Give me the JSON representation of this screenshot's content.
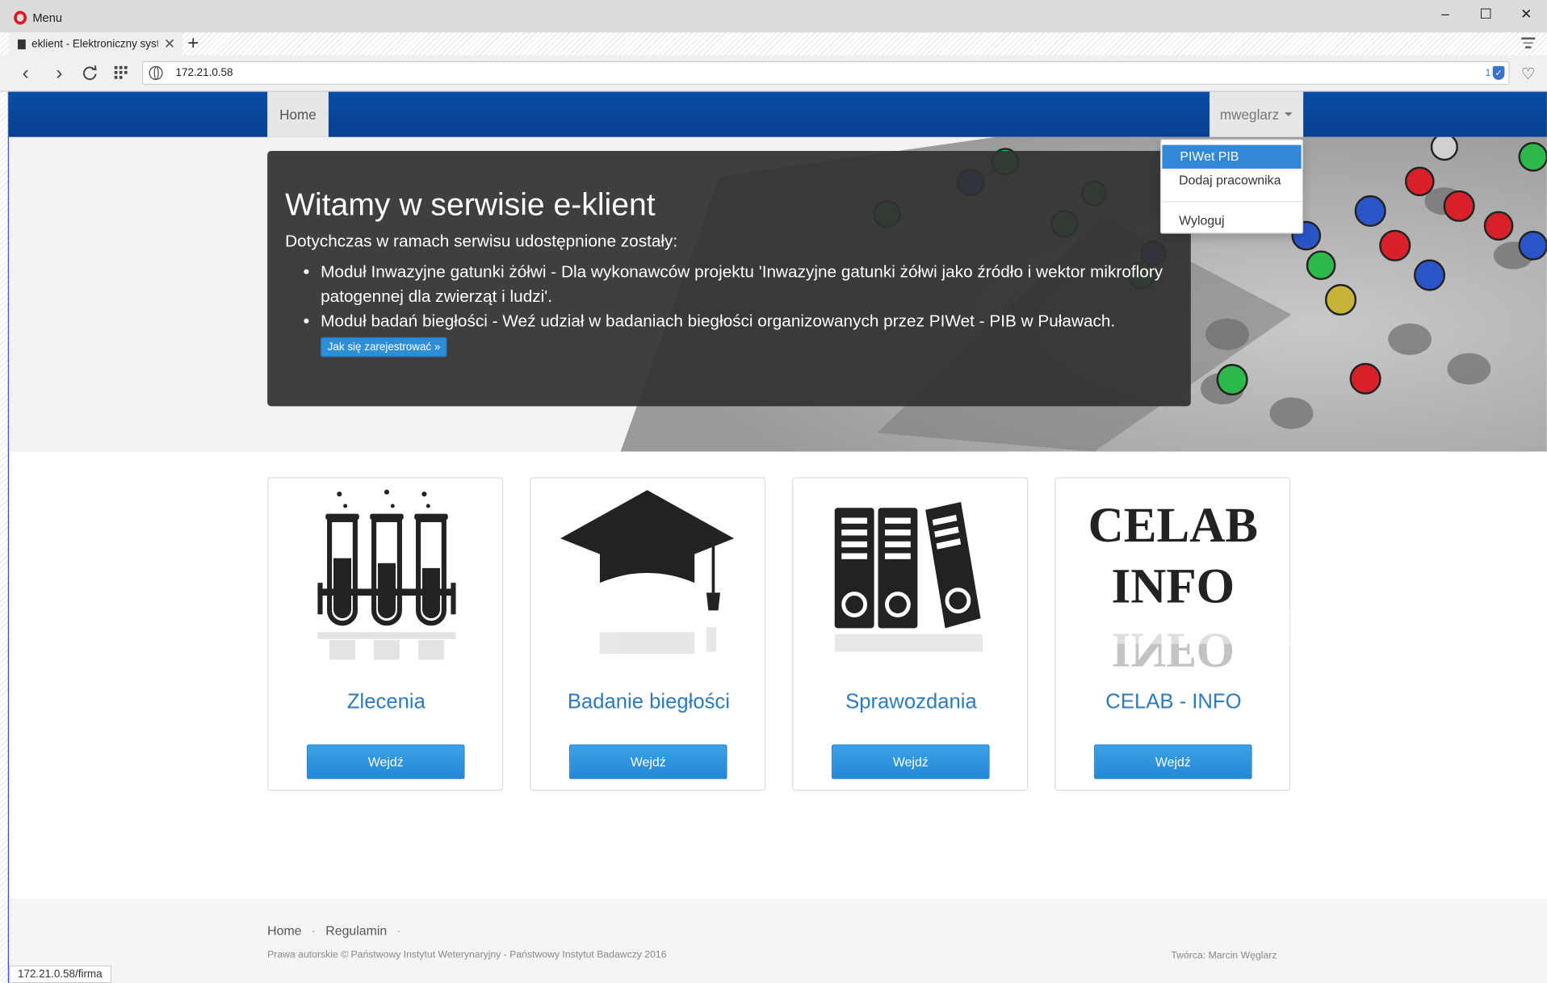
{
  "browser": {
    "menu_label": "Menu",
    "tab_title": "eklient - Elektroniczny syste",
    "url": "172.21.0.58",
    "shield_count": "1",
    "status_url": "172.21.0.58/firma"
  },
  "navbar": {
    "home": "Home",
    "user": "mweglarz"
  },
  "dropdown": {
    "items": [
      "PIWet PIB",
      "Dodaj pracownika"
    ],
    "logout": "Wyloguj"
  },
  "hero": {
    "title": "Witamy w serwisie e-klient",
    "intro": "Dotychczas w ramach serwisu udostępnione zostały:",
    "items": [
      "Moduł Inwazyjne gatunki żółwi - Dla wykonawców projektu 'Inwazyjne gatunki żółwi jako źródło i wektor mikroflory patogennej dla zwierząt i ludzi'.",
      "Moduł badań biegłości - Weź udział w badaniach biegłości organizowanych przez PIWet - PIB w Puławach."
    ],
    "register_button": "Jak się zarejestrować »"
  },
  "cards": [
    {
      "title": "Zlecenia",
      "button": "Wejdź",
      "icon": "test-tubes-icon"
    },
    {
      "title": "Badanie biegłości",
      "button": "Wejdź",
      "icon": "graduation-cap-icon"
    },
    {
      "title": "Sprawozdania",
      "button": "Wejdź",
      "icon": "binders-icon"
    },
    {
      "title": "CELAB - INFO",
      "button": "Wejdź",
      "icon": "celab-info-logo",
      "logo_text": [
        "CELAB",
        "INFO"
      ]
    }
  ],
  "footer": {
    "links": [
      "Home",
      "Regulamin"
    ],
    "copyright": "Prawa autorskie © Państwowy Instytut Weterynaryjny - Państwowy Instytut Badawczy 2016",
    "author": "Twórca: Marcin Węglarz"
  },
  "colors": {
    "navbar": "#0a4da6",
    "accent_button": "#2d8fd8",
    "card_title": "#2d7bbf",
    "dropdown_active": "#3288d6"
  }
}
